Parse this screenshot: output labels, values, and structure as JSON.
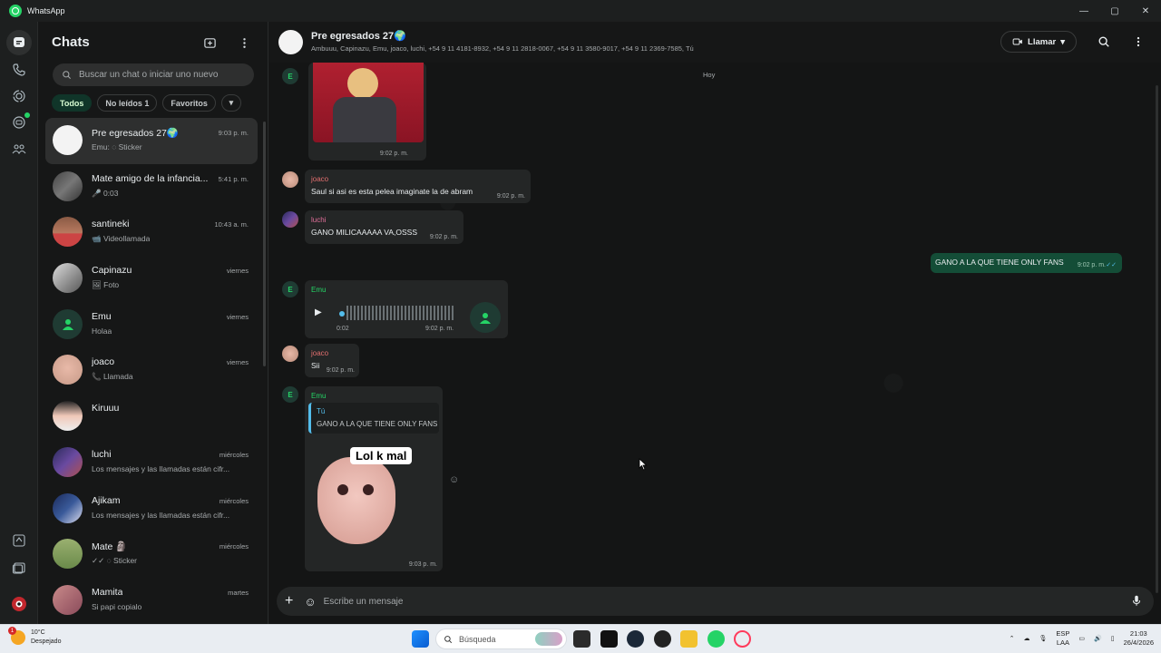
{
  "window": {
    "title": "WhatsApp"
  },
  "sidebar_header": {
    "title": "Chats"
  },
  "search": {
    "placeholder": "Buscar un chat o iniciar uno nuevo"
  },
  "filters": [
    {
      "label": "Todos"
    },
    {
      "label": "No leídos 1"
    },
    {
      "label": "Favoritos"
    }
  ],
  "chats": [
    {
      "name": "Pre egresados 27🌍",
      "time": "9:03 p. m.",
      "preview": "Emu: ◌ Sticker"
    },
    {
      "name": "Mate amigo de la infancia...",
      "time": "5:41 p. m.",
      "preview": "🎤 0:03"
    },
    {
      "name": "santineki",
      "time": "10:43 a. m.",
      "preview": "📹 Videollamada"
    },
    {
      "name": "Capinazu",
      "time": "viernes",
      "preview": "🖼 Foto"
    },
    {
      "name": "Emu",
      "time": "viernes",
      "preview": "Holaa"
    },
    {
      "name": "joaco",
      "time": "viernes",
      "preview": "📞 Llamada"
    },
    {
      "name": "Kiruuu",
      "time": "",
      "preview": ""
    },
    {
      "name": "luchi",
      "time": "miércoles",
      "preview": "Los mensajes y las llamadas están cifr..."
    },
    {
      "name": "Ajikam",
      "time": "miércoles",
      "preview": "Los mensajes y las llamadas están cifr..."
    },
    {
      "name": "Mate 🗿",
      "time": "miércoles",
      "preview": "✓✓ ◌ Sticker"
    },
    {
      "name": "Mamita",
      "time": "martes",
      "preview": "Si papi copialo"
    }
  ],
  "conversation": {
    "title": "Pre egresados 27🌍",
    "members": "Ambuuu, Capinazu, Emu, joaco, luchi, +54 9 11 4181-8932, +54 9 11 2818-0067, +54 9 11 3580-9017, +54 9 11 2369-7585, Tú",
    "call_label": "Llamar",
    "date_divider": "Hoy",
    "messages": {
      "image_time": "9:02 p. m.",
      "m1_sender": "joaco",
      "m1_text": "Saul si asi es esta pelea imaginate la de abram",
      "m1_time": "9:02 p. m.",
      "m2_sender": "luchi",
      "m2_text": "GANO MILICAAAAA VA,OSSS",
      "m2_time": "9:02 p. m.",
      "m3_text": "GANO A LA QUE TIENE ONLY FANS",
      "m3_time": "9:02 p. m.",
      "m4_sender": "Emu",
      "m4_duration": "0:02",
      "m4_time": "9:02 p. m.",
      "m5_sender": "joaco",
      "m5_text": "Sii",
      "m5_time": "9:02 p. m.",
      "m6_sender": "Emu",
      "m6_quote_author": "Tú",
      "m6_quote_text": "GANO A LA QUE TIENE ONLY FANS",
      "m6_sticker_text": "Lol k mal",
      "m6_time": "9:03 p. m.",
      "e_label": "E"
    },
    "composer_placeholder": "Escribe un mensaje"
  },
  "taskbar": {
    "weather_temp": "10°C",
    "weather_desc": "Despejado",
    "search_label": "Búsqueda",
    "lang_top": "ESP",
    "lang_bottom": "LAA",
    "time": "21:03",
    "date": "26/4/2026",
    "badge": "1"
  },
  "colors": {
    "accent": "#25d366",
    "outgoing_bubble": "#144d37",
    "incoming_bubble": "#242626"
  }
}
